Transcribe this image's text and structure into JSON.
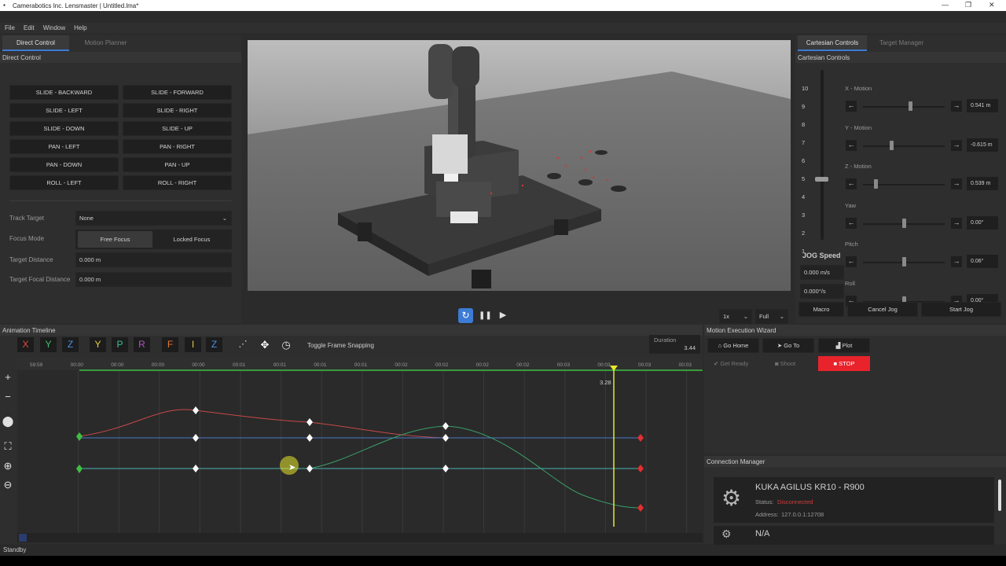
{
  "window": {
    "title": "Camerabotics Inc. Lensmaster | Untitled.lma*",
    "app_icon": "app-icon"
  },
  "menu": [
    "File",
    "Edit",
    "Window",
    "Help"
  ],
  "left_tabs": [
    "Direct Control",
    "Motion Planner"
  ],
  "direct_control": {
    "header": "Direct Control",
    "buttons": [
      [
        "SLIDE - BACKWARD",
        "SLIDE - FORWARD"
      ],
      [
        "SLIDE - LEFT",
        "SLIDE - RIGHT"
      ],
      [
        "SLIDE - DOWN",
        "SLIDE - UP"
      ],
      [
        "PAN - LEFT",
        "PAN - RIGHT"
      ],
      [
        "PAN - DOWN",
        "PAN - UP"
      ],
      [
        "ROLL - LEFT",
        "ROLL - RIGHT"
      ]
    ],
    "track_target_label": "Track Target",
    "track_target_value": "None",
    "focus_mode_label": "Focus Mode",
    "focus_modes": [
      "Free Focus",
      "Locked Focus"
    ],
    "target_distance_label": "Target Distance",
    "target_distance_value": "0.000 m",
    "target_focal_label": "Target Focal Distance",
    "target_focal_value": "0.000 m"
  },
  "viewport": {
    "speed": "1x",
    "quality": "Full"
  },
  "right_tabs": [
    "Cartesian Controls",
    "Target Manager"
  ],
  "cartesian": {
    "header": "Cartesian Controls",
    "scale": [
      "10",
      "9",
      "8",
      "7",
      "6",
      "5",
      "4",
      "3",
      "2",
      "1"
    ],
    "jog_level": 5,
    "jog_speed_label": "JOG Speed",
    "jog_linear": "0.000 m/s",
    "jog_angular": "0.000°/s",
    "axes": [
      {
        "label": "X - Motion",
        "value": "0.541 m",
        "pos": 0.58
      },
      {
        "label": "Y - Motion",
        "value": "-0.615 m",
        "pos": 0.35
      },
      {
        "label": "Z - Motion",
        "value": "0.539 m",
        "pos": 0.15
      },
      {
        "label": "Yaw",
        "value": "0.00°",
        "pos": 0.5
      },
      {
        "label": "Pitch",
        "value": "0.06°",
        "pos": 0.5
      },
      {
        "label": "Roll",
        "value": "0.00°",
        "pos": 0.5
      }
    ],
    "macro": "Macro",
    "cancel_jog": "Cancel Jog",
    "start_jog": "Start Jog"
  },
  "timeline": {
    "header": "Animation Timeline",
    "channels": [
      {
        "label": "X",
        "color": "#e04848"
      },
      {
        "label": "Y",
        "color": "#3fbf6f"
      },
      {
        "label": "Z",
        "color": "#4a8fe0"
      },
      {
        "label": "Y",
        "color": "#e0d040"
      },
      {
        "label": "P",
        "color": "#3fbfa0"
      },
      {
        "label": "R",
        "color": "#b050c0"
      },
      {
        "label": "F",
        "color": "#e07830"
      },
      {
        "label": "I",
        "color": "#e0d040"
      },
      {
        "label": "Z",
        "color": "#4a8fe0"
      }
    ],
    "toggle_snapping": "Toggle Frame Snapping",
    "duration_label": "Duration",
    "duration_value": "3.44",
    "ruler": [
      "59:59",
      "00:00",
      "00:00",
      "00:00",
      "00:00",
      "00:01",
      "00:01",
      "00:01",
      "00:01",
      "00:02",
      "00:02",
      "00:02",
      "00:02",
      "00:03",
      "00:03",
      "00:03",
      "00:03"
    ],
    "playhead_label": "3.28"
  },
  "wizard": {
    "header": "Motion Execution Wizard",
    "go_home": "Go Home",
    "go_to": "Go To",
    "plot": "Plot",
    "get_ready": "Get Ready",
    "shoot": "Shoot",
    "stop": "STOP"
  },
  "connection": {
    "header": "Connection Manager",
    "robot_name": "KUKA AGILUS KR10 - R900",
    "status_label": "Status:",
    "status_value": "Disconnected",
    "address_label": "Address:",
    "address_value": "127.0.0.1:12708",
    "second_name": "N/A"
  },
  "statusbar": "Standby",
  "colors": {
    "accent": "#3d7bd4",
    "stop": "#e8232b",
    "disconnected": "#d33a3a",
    "playhead": "#e8e82a"
  }
}
